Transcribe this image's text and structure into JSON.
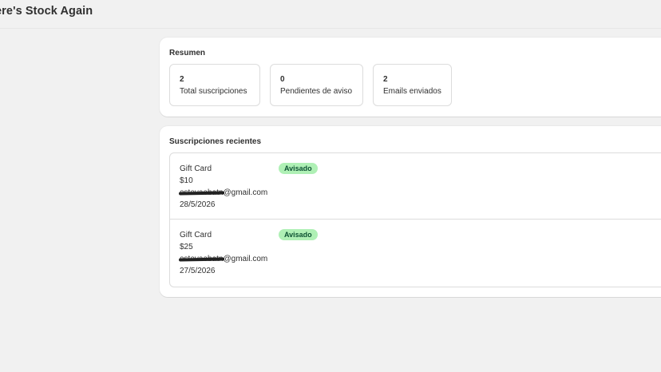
{
  "app": {
    "title": "ere's Stock Again"
  },
  "summary": {
    "title": "Resumen",
    "stats": [
      {
        "value": "2",
        "label": "Total suscripciones"
      },
      {
        "value": "0",
        "label": "Pendientes de aviso"
      },
      {
        "value": "2",
        "label": "Emails enviados"
      }
    ]
  },
  "recent": {
    "title": "Suscripciones recientes",
    "items": [
      {
        "product": "Gift Card",
        "price": "$10",
        "email_user": "estevaebatn",
        "email_domain": "@gmail.com",
        "date": "28/5/2026",
        "status": "Avisado"
      },
      {
        "product": "Gift Card",
        "price": "$25",
        "email_user": "estevaebatn",
        "email_domain": "@gmail.com",
        "date": "27/5/2026",
        "status": "Avisado"
      }
    ]
  },
  "colors": {
    "page_bg": "#f1f1f1",
    "card_bg": "#ffffff",
    "badge_success_bg": "#aff0b5",
    "badge_success_text": "#0c5132"
  }
}
